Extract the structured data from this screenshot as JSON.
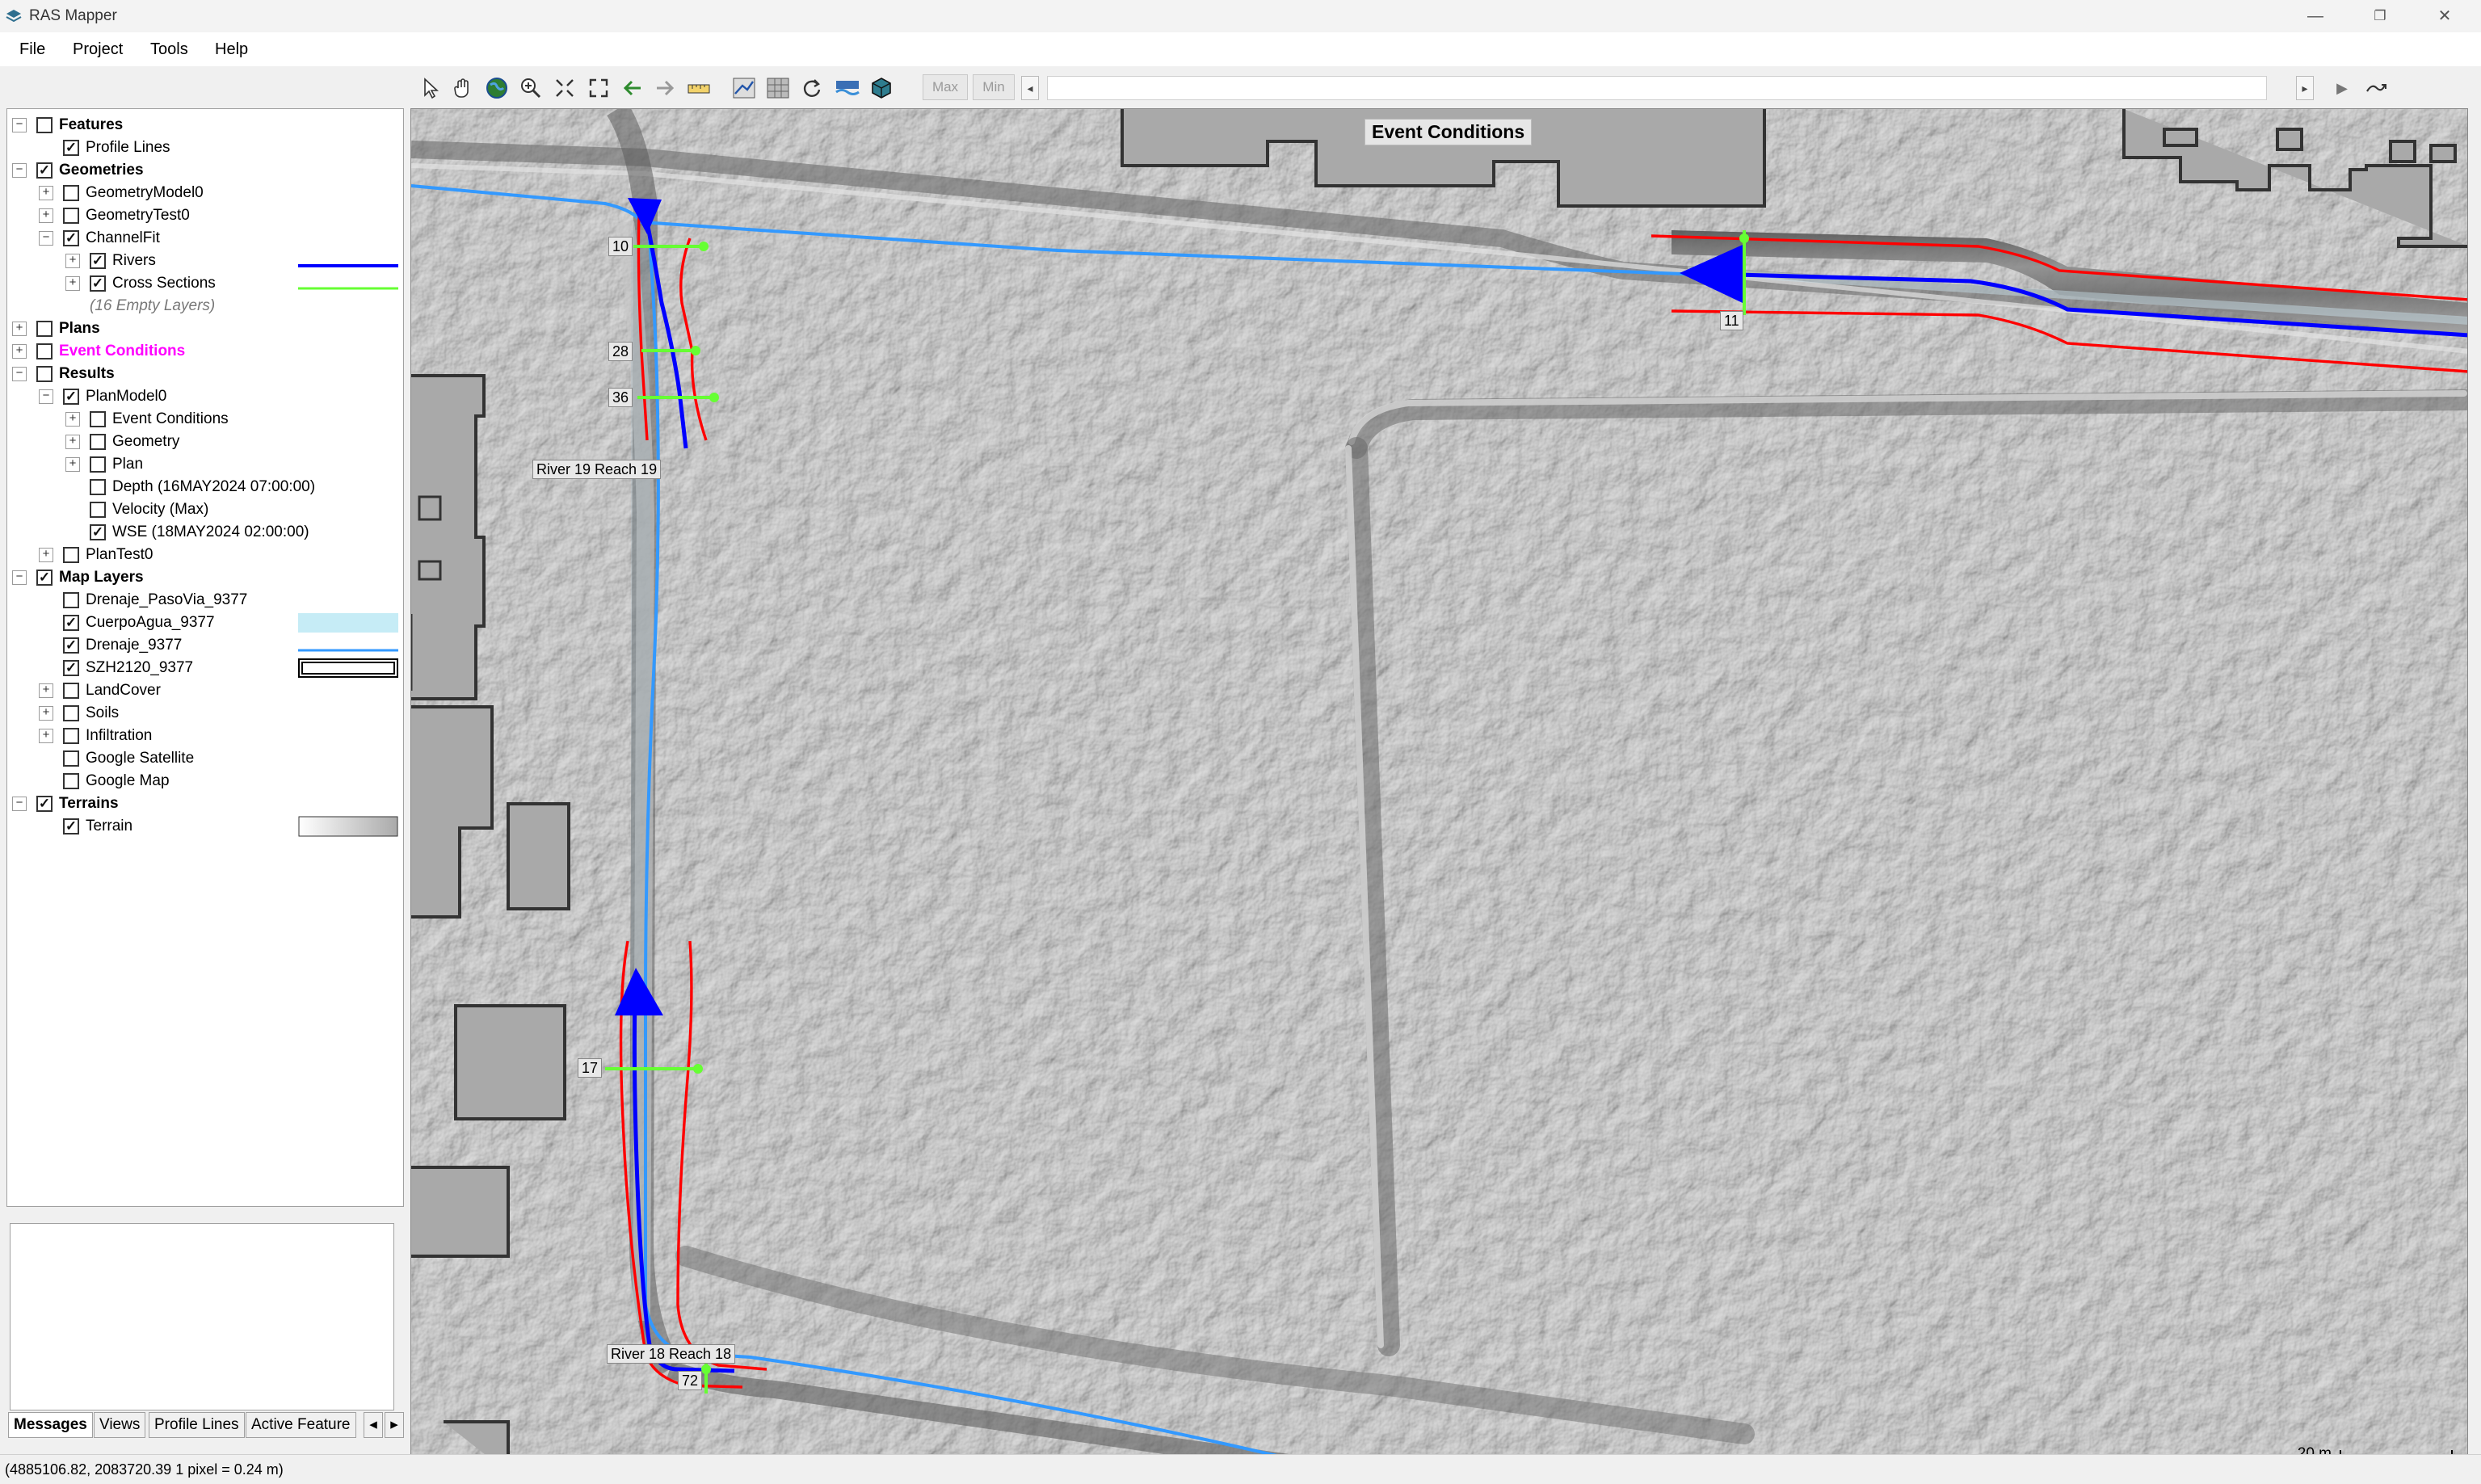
{
  "window": {
    "title": "RAS Mapper",
    "minimize": "—",
    "restore": "❐",
    "close": "✕"
  },
  "menu": [
    "File",
    "Project",
    "Tools",
    "Help"
  ],
  "toolbar": {
    "max_label": "Max",
    "min_label": "Min",
    "left_arrow": "◂",
    "right_arrow": "▸",
    "play": "▶"
  },
  "layers": [
    {
      "label": "Features",
      "level": 0,
      "expander": "−",
      "checked": false,
      "style": "bold"
    },
    {
      "label": "Profile Lines",
      "level": 1,
      "expander": "",
      "checked": true,
      "style": ""
    },
    {
      "label": "Geometries",
      "level": 0,
      "expander": "−",
      "checked": true,
      "style": "bold"
    },
    {
      "label": "GeometryModel0",
      "level": 1,
      "expander": "+",
      "checked": false,
      "style": ""
    },
    {
      "label": "GeometryTest0",
      "level": 1,
      "expander": "+",
      "checked": false,
      "style": ""
    },
    {
      "label": "ChannelFit",
      "level": 1,
      "expander": "−",
      "checked": true,
      "style": ""
    },
    {
      "label": "Rivers",
      "level": 2,
      "expander": "+",
      "checked": true,
      "style": "",
      "swatch": "river"
    },
    {
      "label": "Cross Sections",
      "level": 2,
      "expander": "+",
      "checked": true,
      "style": "",
      "swatch": "xs"
    },
    {
      "label": "(16 Empty Layers)",
      "level": 2,
      "expander": "",
      "checked": null,
      "style": "italic"
    },
    {
      "label": "Plans",
      "level": 0,
      "expander": "+",
      "checked": false,
      "style": "bold"
    },
    {
      "label": "Event Conditions",
      "level": 0,
      "expander": "+",
      "checked": false,
      "style": "magenta"
    },
    {
      "label": "Results",
      "level": 0,
      "expander": "−",
      "checked": false,
      "style": "bold"
    },
    {
      "label": "PlanModel0",
      "level": 1,
      "expander": "−",
      "checked": true,
      "style": ""
    },
    {
      "label": "Event Conditions",
      "level": 2,
      "expander": "+",
      "checked": false,
      "style": ""
    },
    {
      "label": "Geometry",
      "level": 2,
      "expander": "+",
      "checked": false,
      "style": ""
    },
    {
      "label": "Plan",
      "level": 2,
      "expander": "+",
      "checked": false,
      "style": ""
    },
    {
      "label": "Depth (16MAY2024 07:00:00)",
      "level": 2,
      "expander": "",
      "checked": false,
      "style": ""
    },
    {
      "label": "Velocity (Max)",
      "level": 2,
      "expander": "",
      "checked": false,
      "style": ""
    },
    {
      "label": "WSE (18MAY2024 02:00:00)",
      "level": 2,
      "expander": "",
      "checked": true,
      "style": ""
    },
    {
      "label": "PlanTest0",
      "level": 1,
      "expander": "+",
      "checked": false,
      "style": ""
    },
    {
      "label": "Map Layers",
      "level": 0,
      "expander": "−",
      "checked": true,
      "style": "bold"
    },
    {
      "label": "Drenaje_PasoVia_9377",
      "level": 1,
      "expander": "",
      "checked": false,
      "style": ""
    },
    {
      "label": "CuerpoAgua_9377",
      "level": 1,
      "expander": "",
      "checked": true,
      "style": "",
      "swatch": "water"
    },
    {
      "label": "Drenaje_9377",
      "level": 1,
      "expander": "",
      "checked": true,
      "style": "",
      "swatch": "drain"
    },
    {
      "label": "SZH2120_9377",
      "level": 1,
      "expander": "",
      "checked": true,
      "style": "",
      "swatch": "outline"
    },
    {
      "label": "LandCover",
      "level": 1,
      "expander": "+",
      "checked": false,
      "style": ""
    },
    {
      "label": "Soils",
      "level": 1,
      "expander": "+",
      "checked": false,
      "style": ""
    },
    {
      "label": "Infiltration",
      "level": 1,
      "expander": "+",
      "checked": false,
      "style": ""
    },
    {
      "label": "Google Satellite",
      "level": 1,
      "expander": "",
      "checked": false,
      "style": ""
    },
    {
      "label": "Google Map",
      "level": 1,
      "expander": "",
      "checked": false,
      "style": ""
    },
    {
      "label": "Terrains",
      "level": 0,
      "expander": "−",
      "checked": true,
      "style": "bold"
    },
    {
      "label": "Terrain",
      "level": 1,
      "expander": "",
      "checked": true,
      "style": "",
      "swatch": "terrain"
    }
  ],
  "bottom_tabs": [
    "Messages",
    "Views",
    "Profile Lines",
    "Active Feature"
  ],
  "tab_scroll": {
    "left": "◂",
    "right": "▸"
  },
  "map": {
    "title": "Event Conditions",
    "labels": {
      "xs10": "10",
      "xs28": "28",
      "xs36": "36",
      "xs11": "11",
      "xs17": "17",
      "xs72": "72",
      "river19": "River 19  Reach 19",
      "river18": "River 18  Reach 18"
    },
    "scale_text": "20 m"
  },
  "status": "(4885106.82, 2083720.39  1 pixel = 0.24 m)",
  "colors": {
    "river": "#0000ff",
    "cross_section": "#66ff33",
    "bank_line": "#ff0000",
    "drainage": "#3399ff",
    "water_body": "#c6ecf6",
    "event_conditions": "#ff00ff"
  }
}
